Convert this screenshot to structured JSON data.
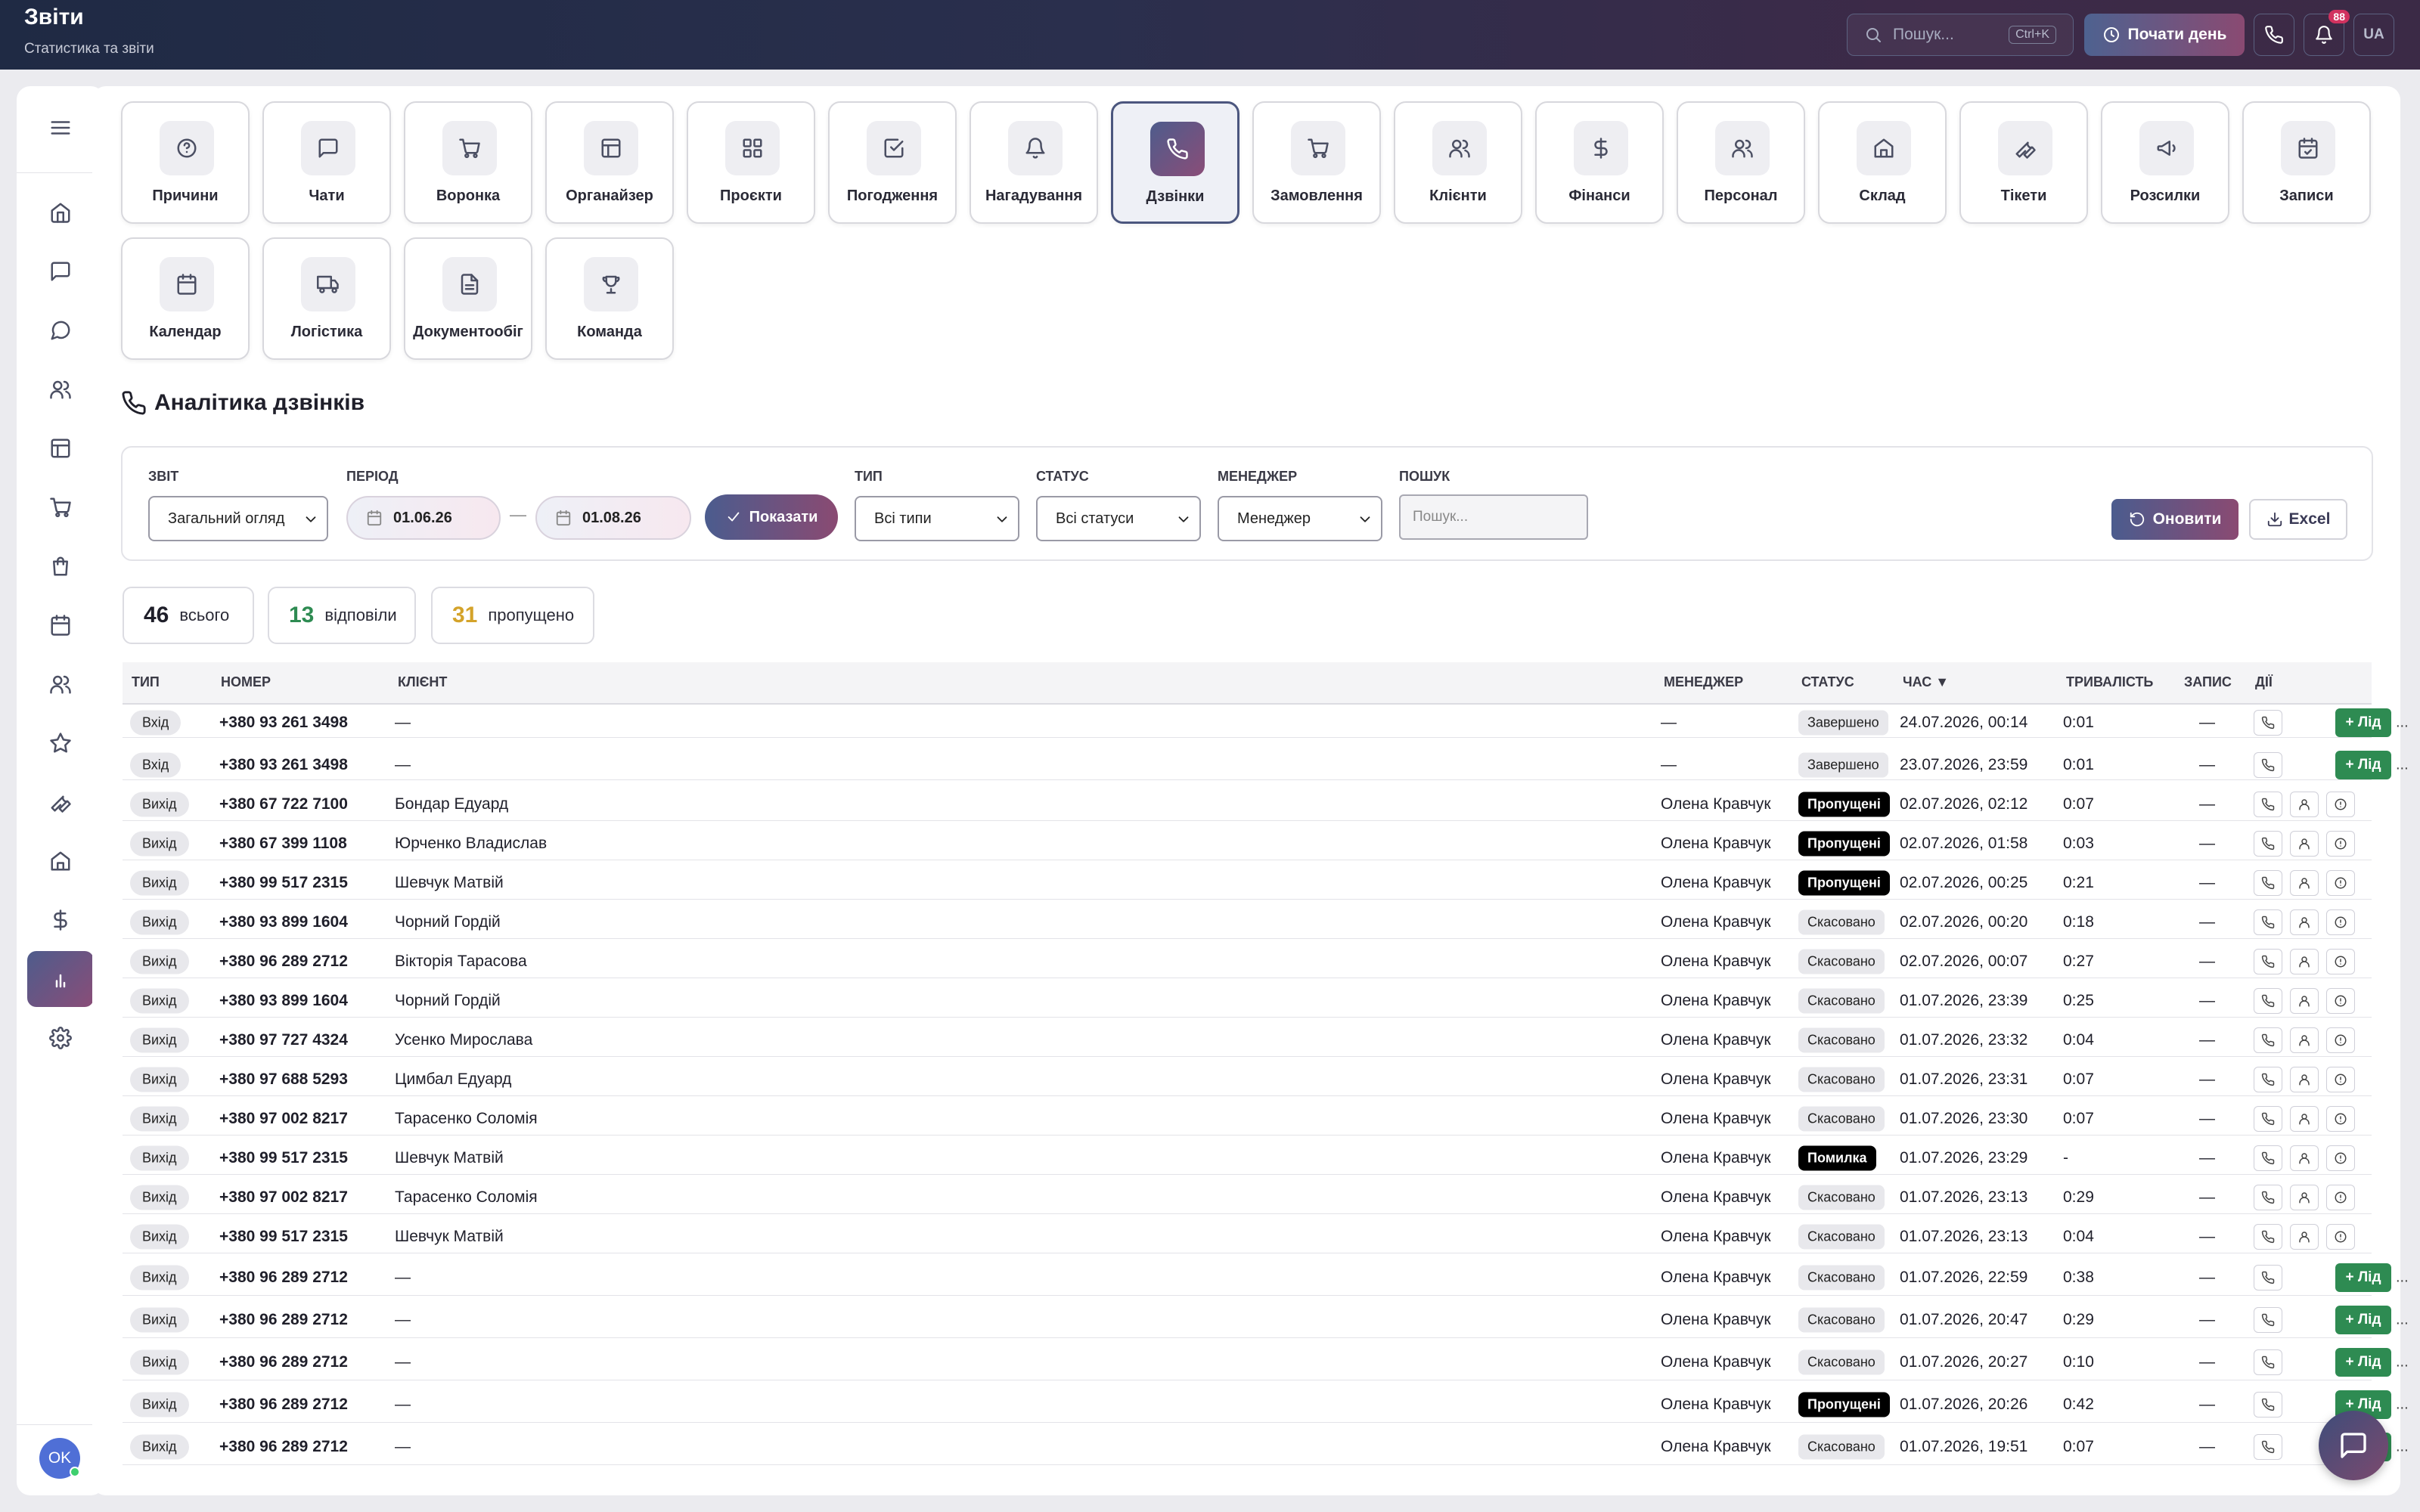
{
  "header": {
    "title": "Звіти",
    "subtitle": "Статистика та звіти",
    "search_placeholder": "Пошук...",
    "search_shortcut": "Ctrl+K",
    "start_day": "Почати день",
    "notif_count": "88",
    "lang": "UA"
  },
  "sidebar": {
    "avatar": "OK"
  },
  "modules": [
    "Причини",
    "Чати",
    "Воронка",
    "Органайзер",
    "Проєкти",
    "Погодження",
    "Нагадування",
    "Дзвінки",
    "Замовлення",
    "Клієнти",
    "Фінанси",
    "Персонал",
    "Склад",
    "Тікети",
    "Розсилки",
    "Записи",
    "Календар",
    "Логістика",
    "Документообіг",
    "Команда"
  ],
  "section_title": "Аналітика дзвінків",
  "filters": {
    "report_label": "ЗВІТ",
    "report_value": "Загальний огляд",
    "period_label": "ПЕРІОД",
    "date_from": "01.06.26",
    "date_sep": "—",
    "date_to": "01.08.26",
    "show_button": "Показати",
    "type_label": "ТИП",
    "type_value": "Всі типи",
    "status_label": "СТАТУС",
    "status_value": "Всі статуси",
    "manager_label": "МЕНЕДЖЕР",
    "manager_value": "Менеджер",
    "search_label": "ПОШУК",
    "search_placeholder": "Пошук...",
    "refresh_button": "Оновити",
    "excel_button": "Excel"
  },
  "stats": {
    "total": "46",
    "total_label": "всього",
    "answered": "13",
    "answered_label": "відповіли",
    "missed": "31",
    "missed_label": "пропущено"
  },
  "table": {
    "headers": {
      "type": "ТИП",
      "number": "НОМЕР",
      "client": "КЛІЄНТ",
      "manager": "МЕНЕДЖЕР",
      "status": "СТАТУС",
      "time": "ЧАС ▼",
      "duration": "ТРИВАЛІСТЬ",
      "record": "ЗАПИС",
      "actions": "ДІЇ"
    },
    "lead_label": "+ Лід",
    "more": "...",
    "rows": [
      {
        "type": "Вхід",
        "number": "+380 93 261 3498",
        "client": "—",
        "manager": "—",
        "status": "Завершено",
        "time": "24.07.2026, 00:14",
        "duration": "0:01",
        "record": "—"
      },
      {
        "type": "Вхід",
        "number": "+380 93 261 3498",
        "client": "—",
        "manager": "—",
        "status": "Завершено",
        "time": "23.07.2026, 23:59",
        "duration": "0:01",
        "record": "—"
      },
      {
        "type": "Вихід",
        "number": "+380 67 722 7100",
        "client": "Бондар Едуард",
        "manager": "Олена Кравчук",
        "status": "Пропущені",
        "time": "02.07.2026, 02:12",
        "duration": "0:07",
        "record": "—"
      },
      {
        "type": "Вихід",
        "number": "+380 67 399 1108",
        "client": "Юрченко Владислав",
        "manager": "Олена Кравчук",
        "status": "Пропущені",
        "time": "02.07.2026, 01:58",
        "duration": "0:03",
        "record": "—"
      },
      {
        "type": "Вихід",
        "number": "+380 99 517 2315",
        "client": "Шевчук Матвій",
        "manager": "Олена Кравчук",
        "status": "Пропущені",
        "time": "02.07.2026, 00:25",
        "duration": "0:21",
        "record": "—"
      },
      {
        "type": "Вихід",
        "number": "+380 93 899 1604",
        "client": "Чорний Гордій",
        "manager": "Олена Кравчук",
        "status": "Скасовано",
        "time": "02.07.2026, 00:20",
        "duration": "0:18",
        "record": "—"
      },
      {
        "type": "Вихід",
        "number": "+380 96 289 2712",
        "client": "Вікторія Тарасова",
        "manager": "Олена Кравчук",
        "status": "Скасовано",
        "time": "02.07.2026, 00:07",
        "duration": "0:27",
        "record": "—"
      },
      {
        "type": "Вихід",
        "number": "+380 93 899 1604",
        "client": "Чорний Гордій",
        "manager": "Олена Кравчук",
        "status": "Скасовано",
        "time": "01.07.2026, 23:39",
        "duration": "0:25",
        "record": "—"
      },
      {
        "type": "Вихід",
        "number": "+380 97 727 4324",
        "client": "Усенко Мирослава",
        "manager": "Олена Кравчук",
        "status": "Скасовано",
        "time": "01.07.2026, 23:32",
        "duration": "0:04",
        "record": "—"
      },
      {
        "type": "Вихід",
        "number": "+380 97 688 5293",
        "client": "Цимбал Едуард",
        "manager": "Олена Кравчук",
        "status": "Скасовано",
        "time": "01.07.2026, 23:31",
        "duration": "0:07",
        "record": "—"
      },
      {
        "type": "Вихід",
        "number": "+380 97 002 8217",
        "client": "Тарасенко Соломія",
        "manager": "Олена Кравчук",
        "status": "Скасовано",
        "time": "01.07.2026, 23:30",
        "duration": "0:07",
        "record": "—"
      },
      {
        "type": "Вихід",
        "number": "+380 99 517 2315",
        "client": "Шевчук Матвій",
        "manager": "Олена Кравчук",
        "status": "Помилка",
        "time": "01.07.2026, 23:29",
        "duration": "-",
        "record": "—"
      },
      {
        "type": "Вихід",
        "number": "+380 97 002 8217",
        "client": "Тарасенко Соломія",
        "manager": "Олена Кравчук",
        "status": "Скасовано",
        "time": "01.07.2026, 23:13",
        "duration": "0:29",
        "record": "—"
      },
      {
        "type": "Вихід",
        "number": "+380 99 517 2315",
        "client": "Шевчук Матвій",
        "manager": "Олена Кравчук",
        "status": "Скасовано",
        "time": "01.07.2026, 23:13",
        "duration": "0:04",
        "record": "—"
      },
      {
        "type": "Вихід",
        "number": "+380 96 289 2712",
        "client": "—",
        "manager": "Олена Кравчук",
        "status": "Скасовано",
        "time": "01.07.2026, 22:59",
        "duration": "0:38",
        "record": "—"
      },
      {
        "type": "Вихід",
        "number": "+380 96 289 2712",
        "client": "—",
        "manager": "Олена Кравчук",
        "status": "Скасовано",
        "time": "01.07.2026, 20:47",
        "duration": "0:29",
        "record": "—"
      },
      {
        "type": "Вихід",
        "number": "+380 96 289 2712",
        "client": "—",
        "manager": "Олена Кравчук",
        "status": "Скасовано",
        "time": "01.07.2026, 20:27",
        "duration": "0:10",
        "record": "—"
      },
      {
        "type": "Вихід",
        "number": "+380 96 289 2712",
        "client": "—",
        "manager": "Олена Кравчук",
        "status": "Пропущені",
        "time": "01.07.2026, 20:26",
        "duration": "0:42",
        "record": "—"
      },
      {
        "type": "Вихід",
        "number": "+380 96 289 2712",
        "client": "—",
        "manager": "Олена Кравчук",
        "status": "Скасовано",
        "time": "01.07.2026, 19:51",
        "duration": "0:07",
        "record": "—"
      }
    ]
  }
}
